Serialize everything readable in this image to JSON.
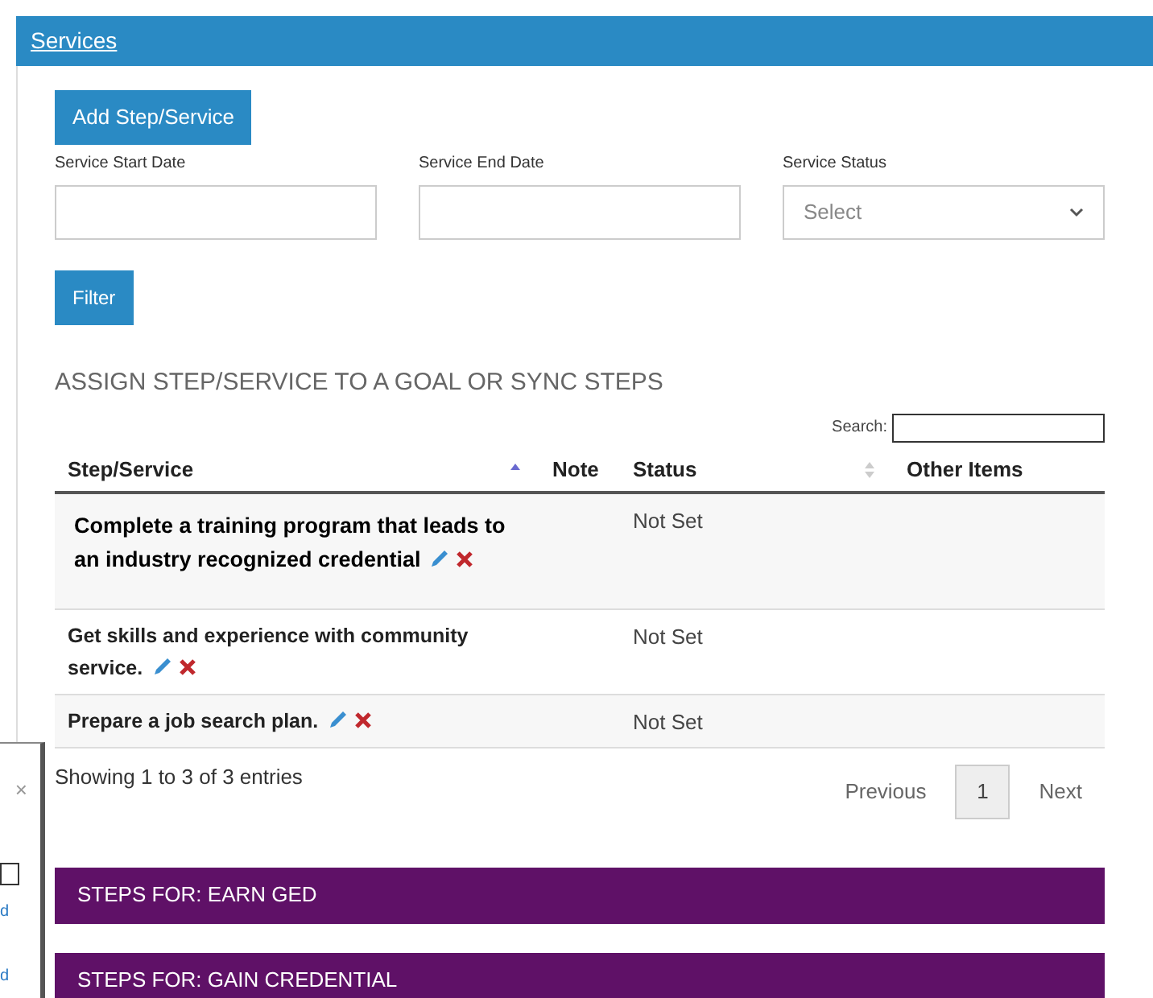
{
  "header": {
    "title": "Services"
  },
  "add_button": "Add Step/Service",
  "filters": [
    {
      "kind": "text",
      "label": "Service Start Date"
    },
    {
      "kind": "text",
      "label": "Service End Date"
    },
    {
      "kind": "select",
      "label": "Service Status",
      "value": "Select"
    }
  ],
  "filter_button": "Filter",
  "section_title": "ASSIGN STEP/SERVICE TO A GOAL OR SYNC STEPS",
  "search": {
    "label": "Search:"
  },
  "table": {
    "columns": [
      {
        "label": "Step/Service",
        "kind": "sortable",
        "sorted": true
      },
      {
        "label": "Note",
        "kind": "plain"
      },
      {
        "label": "Status",
        "kind": "sortable",
        "sorted": false
      },
      {
        "label": "Other Items",
        "kind": "plain"
      }
    ],
    "rows": [
      {
        "step": "Complete a training program that leads to an industry recognized credential",
        "status": "Not Set"
      },
      {
        "step": "Get skills and experience with community service.",
        "status": "Not Set"
      },
      {
        "step": "Prepare a job search plan.",
        "status": "Not Set"
      }
    ]
  },
  "info": "Showing 1 to 3 of 3 entries",
  "pagination": [
    {
      "label": "Previous",
      "selected": false
    },
    {
      "label": "1",
      "selected": true
    },
    {
      "label": "Next",
      "selected": false
    }
  ],
  "goal_panels": [
    "STEPS FOR: EARN GED",
    "STEPS FOR: GAIN CREDENTIAL"
  ],
  "side_window": {
    "close": "×",
    "links": [
      "d",
      "d"
    ]
  }
}
